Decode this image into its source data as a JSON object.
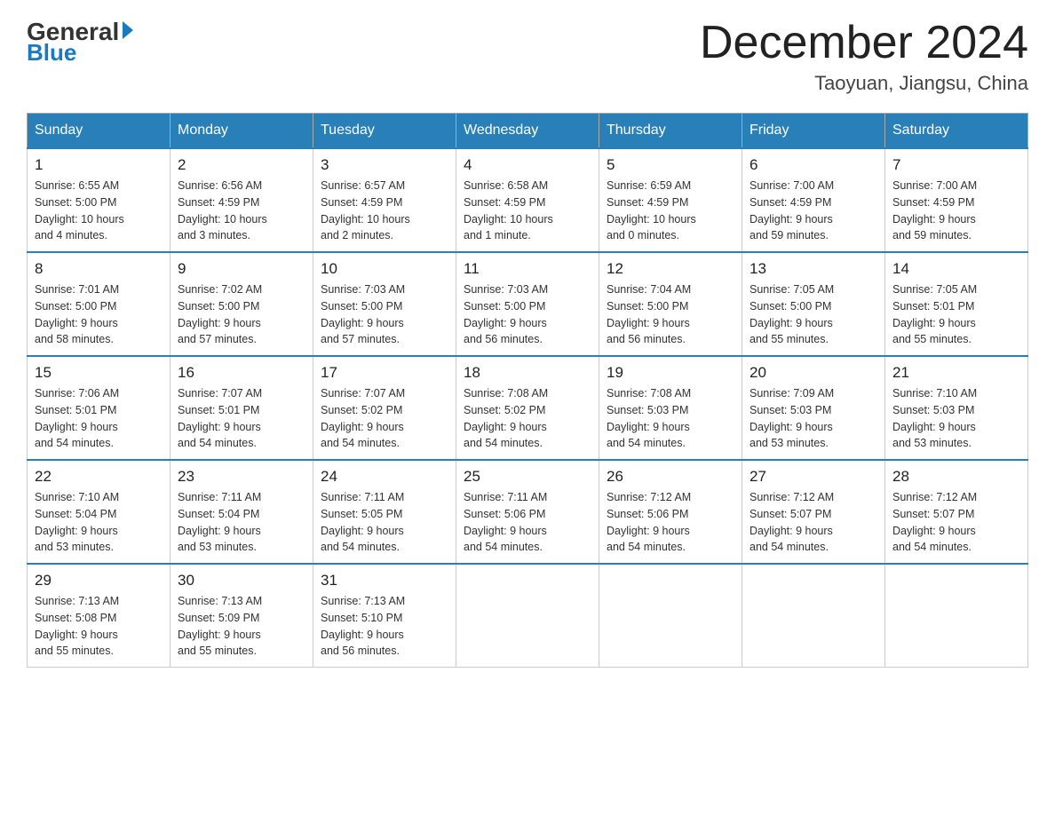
{
  "header": {
    "logo": {
      "general": "General",
      "blue": "Blue"
    },
    "title": "December 2024",
    "location": "Taoyuan, Jiangsu, China"
  },
  "days_of_week": [
    "Sunday",
    "Monday",
    "Tuesday",
    "Wednesday",
    "Thursday",
    "Friday",
    "Saturday"
  ],
  "weeks": [
    [
      {
        "day": "1",
        "info": "Sunrise: 6:55 AM\nSunset: 5:00 PM\nDaylight: 10 hours\nand 4 minutes."
      },
      {
        "day": "2",
        "info": "Sunrise: 6:56 AM\nSunset: 4:59 PM\nDaylight: 10 hours\nand 3 minutes."
      },
      {
        "day": "3",
        "info": "Sunrise: 6:57 AM\nSunset: 4:59 PM\nDaylight: 10 hours\nand 2 minutes."
      },
      {
        "day": "4",
        "info": "Sunrise: 6:58 AM\nSunset: 4:59 PM\nDaylight: 10 hours\nand 1 minute."
      },
      {
        "day": "5",
        "info": "Sunrise: 6:59 AM\nSunset: 4:59 PM\nDaylight: 10 hours\nand 0 minutes."
      },
      {
        "day": "6",
        "info": "Sunrise: 7:00 AM\nSunset: 4:59 PM\nDaylight: 9 hours\nand 59 minutes."
      },
      {
        "day": "7",
        "info": "Sunrise: 7:00 AM\nSunset: 4:59 PM\nDaylight: 9 hours\nand 59 minutes."
      }
    ],
    [
      {
        "day": "8",
        "info": "Sunrise: 7:01 AM\nSunset: 5:00 PM\nDaylight: 9 hours\nand 58 minutes."
      },
      {
        "day": "9",
        "info": "Sunrise: 7:02 AM\nSunset: 5:00 PM\nDaylight: 9 hours\nand 57 minutes."
      },
      {
        "day": "10",
        "info": "Sunrise: 7:03 AM\nSunset: 5:00 PM\nDaylight: 9 hours\nand 57 minutes."
      },
      {
        "day": "11",
        "info": "Sunrise: 7:03 AM\nSunset: 5:00 PM\nDaylight: 9 hours\nand 56 minutes."
      },
      {
        "day": "12",
        "info": "Sunrise: 7:04 AM\nSunset: 5:00 PM\nDaylight: 9 hours\nand 56 minutes."
      },
      {
        "day": "13",
        "info": "Sunrise: 7:05 AM\nSunset: 5:00 PM\nDaylight: 9 hours\nand 55 minutes."
      },
      {
        "day": "14",
        "info": "Sunrise: 7:05 AM\nSunset: 5:01 PM\nDaylight: 9 hours\nand 55 minutes."
      }
    ],
    [
      {
        "day": "15",
        "info": "Sunrise: 7:06 AM\nSunset: 5:01 PM\nDaylight: 9 hours\nand 54 minutes."
      },
      {
        "day": "16",
        "info": "Sunrise: 7:07 AM\nSunset: 5:01 PM\nDaylight: 9 hours\nand 54 minutes."
      },
      {
        "day": "17",
        "info": "Sunrise: 7:07 AM\nSunset: 5:02 PM\nDaylight: 9 hours\nand 54 minutes."
      },
      {
        "day": "18",
        "info": "Sunrise: 7:08 AM\nSunset: 5:02 PM\nDaylight: 9 hours\nand 54 minutes."
      },
      {
        "day": "19",
        "info": "Sunrise: 7:08 AM\nSunset: 5:03 PM\nDaylight: 9 hours\nand 54 minutes."
      },
      {
        "day": "20",
        "info": "Sunrise: 7:09 AM\nSunset: 5:03 PM\nDaylight: 9 hours\nand 53 minutes."
      },
      {
        "day": "21",
        "info": "Sunrise: 7:10 AM\nSunset: 5:03 PM\nDaylight: 9 hours\nand 53 minutes."
      }
    ],
    [
      {
        "day": "22",
        "info": "Sunrise: 7:10 AM\nSunset: 5:04 PM\nDaylight: 9 hours\nand 53 minutes."
      },
      {
        "day": "23",
        "info": "Sunrise: 7:11 AM\nSunset: 5:04 PM\nDaylight: 9 hours\nand 53 minutes."
      },
      {
        "day": "24",
        "info": "Sunrise: 7:11 AM\nSunset: 5:05 PM\nDaylight: 9 hours\nand 54 minutes."
      },
      {
        "day": "25",
        "info": "Sunrise: 7:11 AM\nSunset: 5:06 PM\nDaylight: 9 hours\nand 54 minutes."
      },
      {
        "day": "26",
        "info": "Sunrise: 7:12 AM\nSunset: 5:06 PM\nDaylight: 9 hours\nand 54 minutes."
      },
      {
        "day": "27",
        "info": "Sunrise: 7:12 AM\nSunset: 5:07 PM\nDaylight: 9 hours\nand 54 minutes."
      },
      {
        "day": "28",
        "info": "Sunrise: 7:12 AM\nSunset: 5:07 PM\nDaylight: 9 hours\nand 54 minutes."
      }
    ],
    [
      {
        "day": "29",
        "info": "Sunrise: 7:13 AM\nSunset: 5:08 PM\nDaylight: 9 hours\nand 55 minutes."
      },
      {
        "day": "30",
        "info": "Sunrise: 7:13 AM\nSunset: 5:09 PM\nDaylight: 9 hours\nand 55 minutes."
      },
      {
        "day": "31",
        "info": "Sunrise: 7:13 AM\nSunset: 5:10 PM\nDaylight: 9 hours\nand 56 minutes."
      },
      {
        "day": "",
        "info": ""
      },
      {
        "day": "",
        "info": ""
      },
      {
        "day": "",
        "info": ""
      },
      {
        "day": "",
        "info": ""
      }
    ]
  ]
}
